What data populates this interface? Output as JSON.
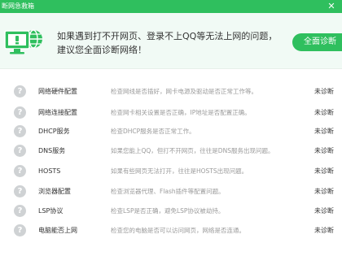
{
  "window": {
    "title": "断网急救箱"
  },
  "banner": {
    "message_line1": "如果遇到打不开网页、登录不上QQ等无法上网的问题，",
    "message_line2": "建议您全面诊断网络！",
    "button_label": "全面诊断"
  },
  "items": [
    {
      "name": "网络硬件配置",
      "desc": "检查网线是否插好，网卡电源及驱动是否正常工作等。",
      "status": "未诊断"
    },
    {
      "name": "网络连接配置",
      "desc": "检查网卡相关设置是否正确，IP地址是否配置正确。",
      "status": "未诊断"
    },
    {
      "name": "DHCP服务",
      "desc": "检查DHCP服务是否正常工作。",
      "status": "未诊断"
    },
    {
      "name": "DNS服务",
      "desc": "如果您能上QQ，但打不开网页，往往是DNS服务出现问题。",
      "status": "未诊断"
    },
    {
      "name": "HOSTS",
      "desc": "如果有些网页无法打开，往往是HOSTS出现问题。",
      "status": "未诊断"
    },
    {
      "name": "浏览器配置",
      "desc": "检查浏览器代理、Flash插件等配置问题。",
      "status": "未诊断"
    },
    {
      "name": "LSP协议",
      "desc": "检查LSP是否正确，避免LSP协议被劫持。",
      "status": "未诊断"
    },
    {
      "name": "电脑能否上网",
      "desc": "检查您的电脑是否可以访问网页，网络是否连通。",
      "status": "未诊断"
    }
  ]
}
